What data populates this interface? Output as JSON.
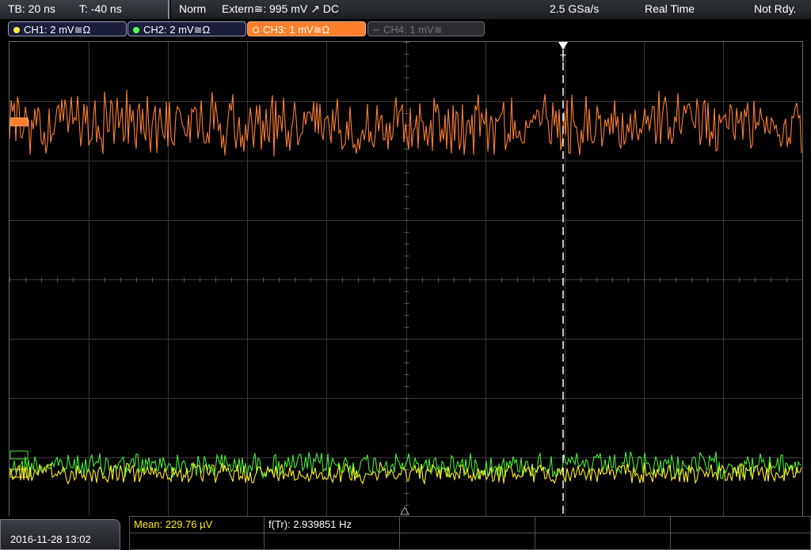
{
  "status": {
    "timebase": "TB: 20 ns",
    "trigger_time": "T: -40 ns",
    "trigger_mode": "Norm",
    "trigger_source": "Extern≅: 995 mV ↗ DC",
    "sample_rate": "2.5 GSa/s",
    "acq_mode": "Real Time",
    "state": "Not Rdy."
  },
  "channels": [
    {
      "label": "CH1: 2 mV≅Ω",
      "color": "#ffee44",
      "active": false
    },
    {
      "label": "CH2: 2 mV≅Ω",
      "color": "#55ff55",
      "active": false
    },
    {
      "label": "CH3: 1 mV≅Ω",
      "color": "#ff7f2a",
      "active": true
    },
    {
      "label": "CH4: 1 mV≅",
      "color": "#707378",
      "active": false
    }
  ],
  "trigger_marker": "T",
  "measurements": {
    "mean": "Mean: 229.76 µV",
    "freq": "f(Tr): 2.939851 Hz"
  },
  "datetime": "2016-11-28 13:02",
  "traces": {
    "ch1_color": "#ffee22",
    "ch2_color": "#44ee33",
    "ch3_color": "#ff8030"
  }
}
